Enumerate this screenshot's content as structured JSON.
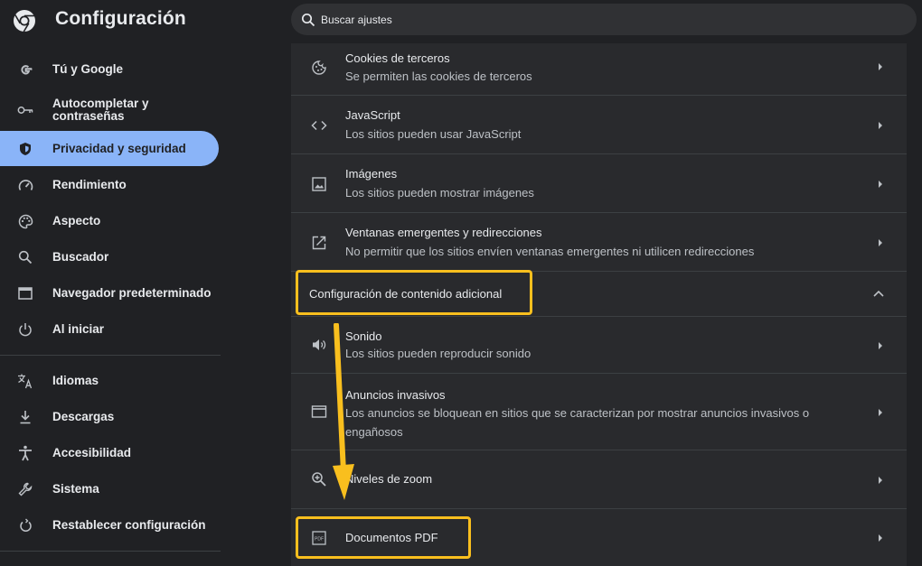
{
  "header": {
    "title": "Configuración",
    "search_placeholder": "Buscar ajustes"
  },
  "sidebar": {
    "items": [
      {
        "label": "Tú y Google",
        "icon": "google-g-icon"
      },
      {
        "label": "Autocompletar y contraseñas",
        "icon": "key-icon"
      },
      {
        "label": "Privacidad y seguridad",
        "icon": "shield-icon",
        "active": true
      },
      {
        "label": "Rendimiento",
        "icon": "speedometer-icon"
      },
      {
        "label": "Aspecto",
        "icon": "palette-icon"
      },
      {
        "label": "Buscador",
        "icon": "search-icon"
      },
      {
        "label": "Navegador predeterminado",
        "icon": "browser-window-icon"
      },
      {
        "label": "Al iniciar",
        "icon": "power-icon"
      },
      {
        "label": "Idiomas",
        "icon": "translate-icon"
      },
      {
        "label": "Descargas",
        "icon": "download-icon"
      },
      {
        "label": "Accesibilidad",
        "icon": "accessibility-icon"
      },
      {
        "label": "Sistema",
        "icon": "wrench-icon"
      },
      {
        "label": "Restablecer configuración",
        "icon": "reset-icon"
      }
    ]
  },
  "content": {
    "rows": [
      {
        "title": "Cookies de terceros",
        "subtitle": "Se permiten las cookies de terceros",
        "icon": "cookie-icon"
      },
      {
        "title": "JavaScript",
        "subtitle": "Los sitios pueden usar JavaScript",
        "icon": "code-icon"
      },
      {
        "title": "Imágenes",
        "subtitle": "Los sitios pueden mostrar imágenes",
        "icon": "image-icon"
      },
      {
        "title": "Ventanas emergentes y redirecciones",
        "subtitle": "No permitir que los sitios envíen ventanas emergentes ni utilicen redirecciones",
        "icon": "popup-icon"
      }
    ],
    "additional_section": {
      "title": "Configuración de contenido adicional",
      "expanded": true,
      "rows": [
        {
          "title": "Sonido",
          "subtitle": "Los sitios pueden reproducir sonido",
          "icon": "speaker-icon"
        },
        {
          "title": "Anuncios invasivos",
          "subtitle": "Los anuncios se bloquean en sitios que se caracterizan por mostrar anuncios invasivos o engañosos",
          "icon": "ad-window-icon"
        },
        {
          "title": "Niveles de zoom",
          "icon": "zoom-icon"
        },
        {
          "title": "Documentos PDF",
          "icon": "pdf-icon"
        }
      ]
    }
  },
  "colors": {
    "accent": "#8ab4f8",
    "highlight": "#f9bf1e",
    "background": "#202124",
    "panel": "#292a2d"
  }
}
